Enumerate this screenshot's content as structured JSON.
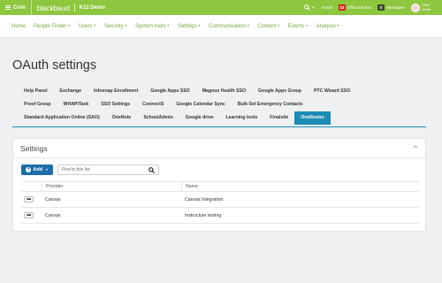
{
  "topbar": {
    "core_label": "Core",
    "brand": "blackbaud",
    "school": "K12 Demo",
    "email_label": "Email",
    "official_notes": {
      "count": "33",
      "label": "Official Notes"
    },
    "messages": {
      "count": "0",
      "label": "Messages"
    },
    "user": {
      "name": "Peter Wolfe"
    },
    "colors": {
      "bar": "#8dc63f",
      "notes_badge": "#d9261c"
    }
  },
  "nav": {
    "items": [
      {
        "label": "Home",
        "caret": ""
      },
      {
        "label": "People Finder",
        "caret": "▼"
      },
      {
        "label": "Users",
        "caret": "▼"
      },
      {
        "label": "Security",
        "caret": "▼"
      },
      {
        "label": "System tools",
        "caret": "▼"
      },
      {
        "label": "Settings",
        "caret": "▼"
      },
      {
        "label": "Communication",
        "caret": "▼"
      },
      {
        "label": "Content",
        "caret": "▼"
      },
      {
        "label": "Events",
        "caret": "▼"
      },
      {
        "label": "Analysis",
        "caret": "▼"
      }
    ]
  },
  "page": {
    "title": "OAuth settings"
  },
  "tabs": {
    "rows": [
      [
        "Help Panel",
        "Exchange",
        "Infosnap Enrollment",
        "Google Apps SSO",
        "Magnus Health SSO",
        "Google Apps Group",
        "PTC Wizard SSO"
      ],
      [
        "Proof Group",
        "WHAPITask",
        "SSO Settings",
        "ConnectS",
        "Google Calendar Sync",
        "Bulk Set Emergency Contacts"
      ],
      [
        "Standard Application Online (SAO)",
        "OneNote",
        "SchoolAdmin",
        "Google drive",
        "Learning tools",
        "Finalsite",
        "OneRoster"
      ]
    ],
    "active": "OneRoster",
    "active_color": "#1c8bb5"
  },
  "panel": {
    "title": "Settings",
    "add_label": "Add",
    "search_placeholder": "Find in this list",
    "columns": [
      "Provider",
      "Name"
    ],
    "rows": [
      {
        "provider": "Canvas",
        "name": "Canvas Integration"
      },
      {
        "provider": "Canvas",
        "name": "Instructure testing"
      }
    ]
  }
}
